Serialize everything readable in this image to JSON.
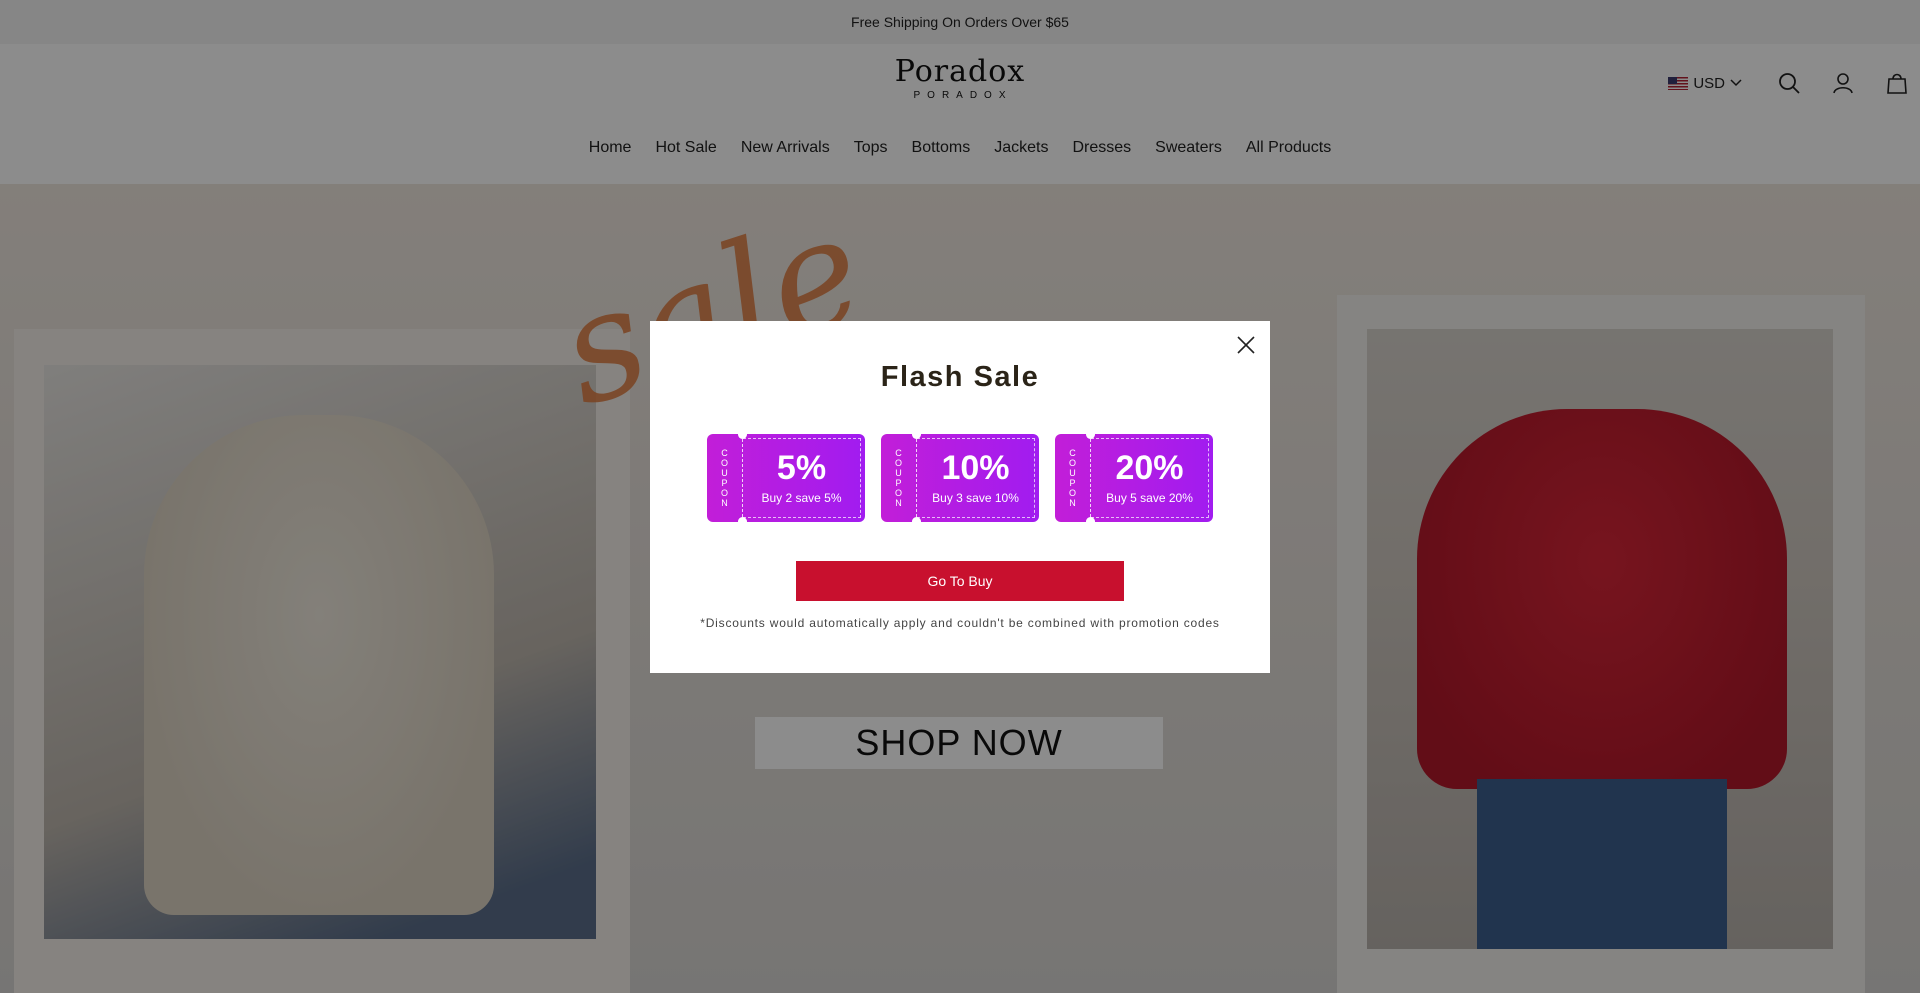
{
  "announcement": "Free Shipping On Orders Over $65",
  "logo": {
    "main": "Poradox",
    "sub": "PORADOX"
  },
  "header": {
    "currency": "USD",
    "icons": [
      "flag-us-icon",
      "chevron-down-icon",
      "search-icon",
      "account-icon",
      "cart-icon"
    ]
  },
  "nav": [
    "Home",
    "Hot Sale",
    "New Arrivals",
    "Tops",
    "Bottoms",
    "Jackets",
    "Dresses",
    "Sweaters",
    "All Products"
  ],
  "hero": {
    "script_text": "sale",
    "cta": "SHOP NOW"
  },
  "modal": {
    "title": "Flash Sale",
    "coupon_stub_text": "COUPON",
    "coupons": [
      {
        "pct": "5%",
        "desc": "Buy 2 save 5%"
      },
      {
        "pct": "10%",
        "desc": "Buy 3 save 10%"
      },
      {
        "pct": "20%",
        "desc": "Buy 5 save 20%"
      }
    ],
    "button": "Go To Buy",
    "disclaimer": "*Discounts would automatically apply and couldn't be combined with promotion codes"
  },
  "colors": {
    "coupon_start": "#c21ed8",
    "coupon_end": "#a11cf0",
    "button": "#c8102e",
    "overlay": "rgba(0,0,0,0.45)"
  }
}
